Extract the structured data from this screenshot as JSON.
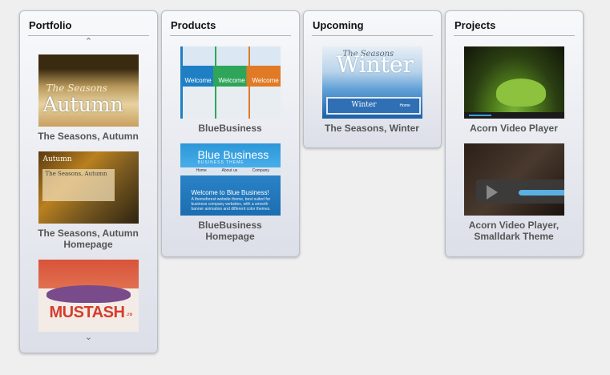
{
  "panels": {
    "portfolio": {
      "title": "Portfolio",
      "up_arrow": "⌃",
      "down_arrow": "⌄",
      "items": [
        {
          "caption": "The Seasons, Autumn",
          "thumb_text": "Autumn",
          "thumb_sub": "The Seasons"
        },
        {
          "caption": "The Seasons, Autumn Homepage",
          "thumb_text": "Autumn",
          "thumb_sub": "The Seasons, Autumn"
        },
        {
          "caption": "",
          "thumb_text": "MUSTASH",
          "thumb_sub": ".ro"
        }
      ]
    },
    "products": {
      "title": "Products",
      "items": [
        {
          "caption": "BlueBusiness",
          "thumb_text": "Welcome"
        },
        {
          "caption": "BlueBusiness Homepage",
          "thumb_text": "Blue Business",
          "thumb_tag": "BUSINESS THEME",
          "thumb_nav": [
            "Home",
            "About us",
            "Company"
          ],
          "thumb_welcome": "Welcome to Blue Business!",
          "thumb_body": "A themeforest website theme, best suited for business company websites, with a smooth banner animation and different color themes."
        }
      ]
    },
    "upcoming": {
      "title": "Upcoming",
      "items": [
        {
          "caption": "The Seasons, Winter",
          "thumb_text": "Winter",
          "thumb_sub": "The Seasons",
          "thumb_frame": "Winter",
          "thumb_menu": "Home"
        }
      ]
    },
    "projects": {
      "title": "Projects",
      "items": [
        {
          "caption": "Acorn Video Player"
        },
        {
          "caption": "Acorn Video Player, Smalldark Theme"
        }
      ]
    }
  }
}
